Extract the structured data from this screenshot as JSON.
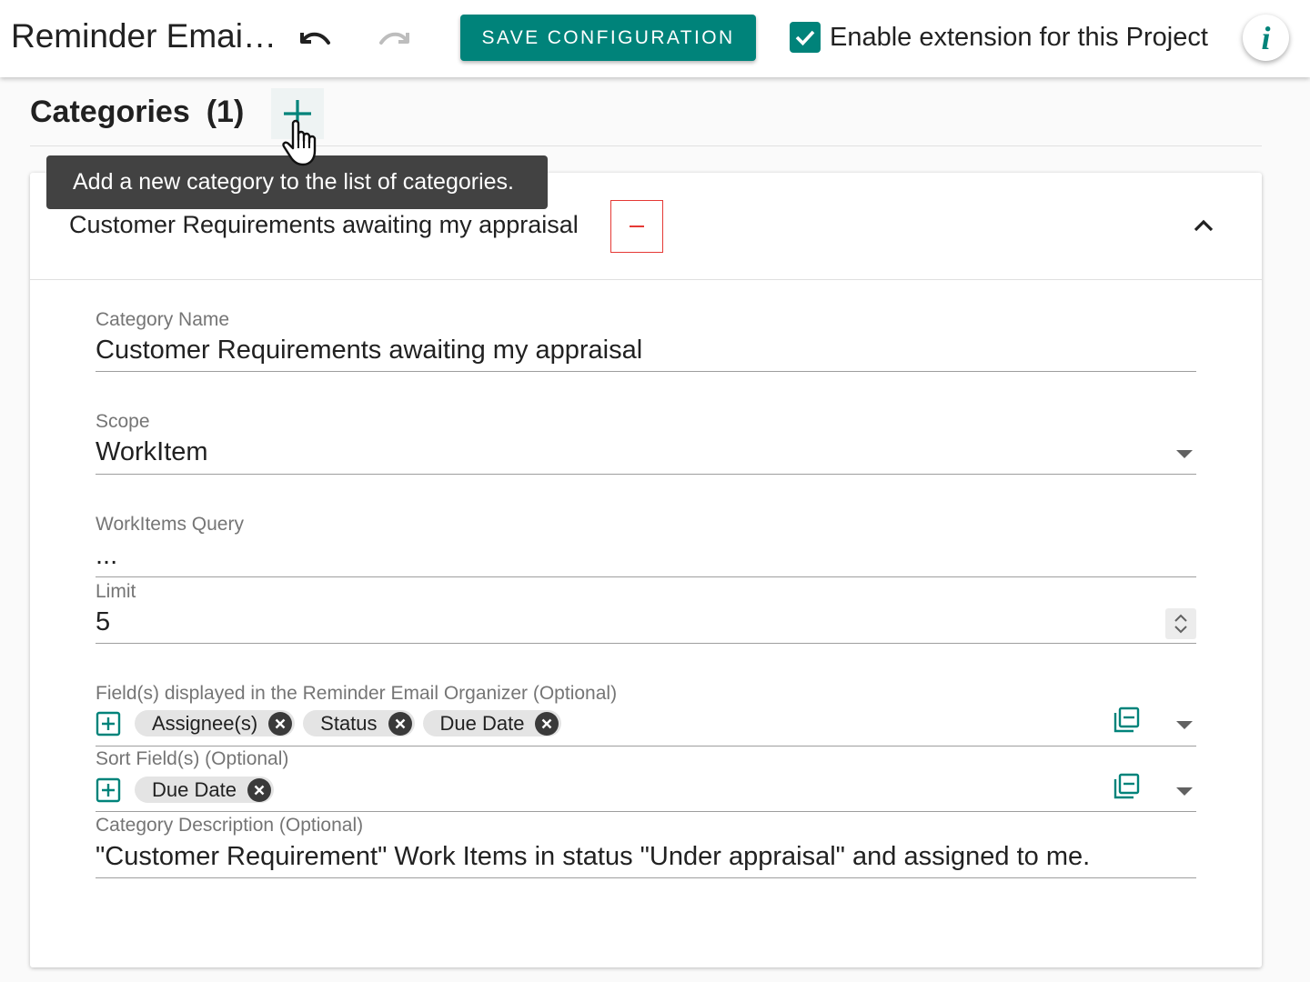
{
  "topbar": {
    "title": "Reminder Email Organizer",
    "save_label": "SAVE CONFIGURATION",
    "enable_label": "Enable extension for this Project",
    "enable_checked": true
  },
  "categories": {
    "title": "Categories",
    "count": "(1)",
    "add_tooltip": "Add a new category to the list of categories."
  },
  "category": {
    "header_title": "Customer Requirements awaiting my appraisal",
    "fields": {
      "name": {
        "label": "Category Name",
        "value": "Customer Requirements awaiting my appraisal"
      },
      "scope": {
        "label": "Scope",
        "value": "WorkItem"
      },
      "query": {
        "label": "WorkItems Query",
        "value": "..."
      },
      "limit": {
        "label": "Limit",
        "value": "5"
      },
      "displayed": {
        "label": "Field(s) displayed in the Reminder Email Organizer (Optional)",
        "chips": [
          "Assignee(s)",
          "Status",
          "Due Date"
        ]
      },
      "sort": {
        "label": "Sort Field(s) (Optional)",
        "chips": [
          "Due Date"
        ]
      },
      "description": {
        "label": "Category Description (Optional)",
        "value": "\"Customer Requirement\" Work Items in status \"Under appraisal\" and assigned to me."
      }
    }
  },
  "colors": {
    "accent": "#00837a",
    "danger": "#e53935",
    "tooltip": "#424242"
  },
  "icons": [
    "undo-icon",
    "redo-icon",
    "check-icon",
    "info-icon",
    "plus-icon",
    "hand-cursor-icon",
    "minus-icon",
    "chevron-up-icon",
    "chevron-down-icon",
    "spinner-icon",
    "add-box-icon",
    "close-circle-icon",
    "list-icon"
  ]
}
